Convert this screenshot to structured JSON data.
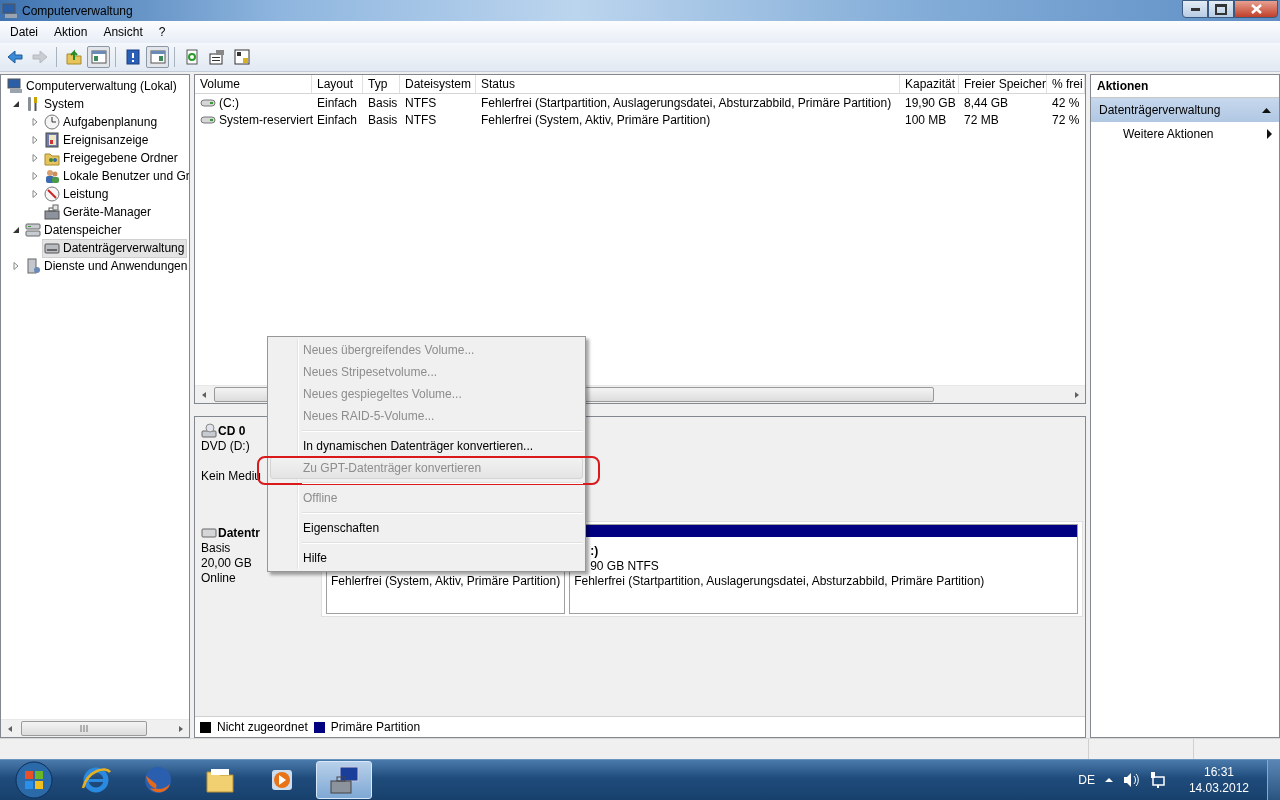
{
  "window": {
    "title": "Computerverwaltung"
  },
  "menu_bar": [
    {
      "label": "Datei"
    },
    {
      "label": "Aktion"
    },
    {
      "label": "Ansicht"
    },
    {
      "label": "?"
    }
  ],
  "toolbar": [
    {
      "kind": "button",
      "disabled": false,
      "pressed": false
    },
    {
      "kind": "button",
      "disabled": true,
      "pressed": false
    },
    {
      "kind": "separator"
    },
    {
      "kind": "button",
      "disabled": false,
      "pressed": false
    },
    {
      "kind": "button",
      "disabled": false,
      "pressed": true
    },
    {
      "kind": "separator"
    },
    {
      "kind": "button",
      "disabled": false,
      "pressed": false
    },
    {
      "kind": "button",
      "disabled": false,
      "pressed": true
    },
    {
      "kind": "separator"
    },
    {
      "kind": "button",
      "disabled": false,
      "pressed": false
    },
    {
      "kind": "button",
      "disabled": false,
      "pressed": false
    },
    {
      "kind": "button",
      "disabled": false,
      "pressed": false
    }
  ],
  "tree": [
    {
      "label": "Computerverwaltung (Lokal)",
      "selected": false,
      "children": [
        {
          "label": "System",
          "kind": "expanded",
          "selected": false,
          "children": [
            {
              "label": "Aufgabenplanung",
              "kind": "collapsed",
              "selected": false
            },
            {
              "label": "Ereignisanzeige",
              "kind": "collapsed",
              "selected": false
            },
            {
              "label": "Freigegebene Ordner",
              "kind": "collapsed",
              "selected": false
            },
            {
              "label": "Lokale Benutzer und Gr",
              "kind": "collapsed",
              "selected": false
            },
            {
              "label": "Leistung",
              "kind": "collapsed",
              "selected": false
            },
            {
              "label": "Geräte-Manager",
              "kind": "leaf",
              "selected": false
            }
          ]
        },
        {
          "label": "Datenspeicher",
          "kind": "expanded",
          "selected": false,
          "children": [
            {
              "label": "Datenträgerverwaltung",
              "kind": "leaf",
              "selected": true
            }
          ]
        },
        {
          "label": "Dienste und Anwendungen",
          "kind": "collapsed",
          "selected": false
        }
      ]
    }
  ],
  "table": {
    "columns": [
      "Volume",
      "Layout",
      "Typ",
      "Dateisystem",
      "Status",
      "Kapazität",
      "Freier Speicher",
      "% frei"
    ],
    "rows": [
      [
        "(C:)",
        "Einfach",
        "Basis",
        "NTFS",
        "Fehlerfrei (Startpartition, Auslagerungsdatei, Absturzabbild, Primäre Partition)",
        "19,90 GB",
        "8,44 GB",
        "42 %"
      ],
      [
        "System-reserviert",
        "Einfach",
        "Basis",
        "NTFS",
        "Fehlerfrei (System, Aktiv, Primäre Partition)",
        "100 MB",
        "72 MB",
        "72 %"
      ]
    ]
  },
  "disks": [
    {
      "kind": "cd",
      "name": "CD 0",
      "type": "DVD (D:)",
      "status": "Kein Mediu"
    },
    {
      "kind": "disk",
      "name": "Datentr",
      "type": "Basis",
      "size": "20,00 GB",
      "status": "Online",
      "partitions": [
        {
          "status": "Fehlerfrei (System, Aktiv, Primäre Partition)"
        },
        {
          "name": ":)",
          "size": "90 GB NTFS",
          "status": "Fehlerfrei (Startpartition, Auslagerungsdatei, Absturzabbild, Primäre Partition)",
          "color": "#000080"
        }
      ]
    }
  ],
  "legend": [
    {
      "label": "Nicht zugeordnet",
      "color": "#000000"
    },
    {
      "label": "Primäre Partition",
      "color": "#000080"
    }
  ],
  "actions": {
    "header": "Aktionen",
    "section": {
      "label": "Datenträgerverwaltung",
      "expanded": true
    },
    "items": [
      {
        "label": "Weitere Aktionen"
      }
    ]
  },
  "context_menu": {
    "items": [
      {
        "kind": "item",
        "label": "Neues übergreifendes Volume...",
        "disabled": true,
        "highlighted": false
      },
      {
        "kind": "item",
        "label": "Neues Stripesetvolume...",
        "disabled": true,
        "highlighted": false
      },
      {
        "kind": "item",
        "label": "Neues gespiegeltes Volume...",
        "disabled": true,
        "highlighted": false
      },
      {
        "kind": "item",
        "label": "Neues RAID-5-Volume...",
        "disabled": true,
        "highlighted": false
      },
      {
        "kind": "separator"
      },
      {
        "kind": "item",
        "label": "In dynamischen Datenträger konvertieren...",
        "disabled": false,
        "highlighted": false
      },
      {
        "kind": "item",
        "label": "Zu GPT-Datenträger konvertieren",
        "disabled": true,
        "highlighted": true,
        "annotated": true
      },
      {
        "kind": "separator"
      },
      {
        "kind": "item",
        "label": "Offline",
        "disabled": true,
        "highlighted": false
      },
      {
        "kind": "separator"
      },
      {
        "kind": "item",
        "label": "Eigenschaften",
        "disabled": false,
        "highlighted": false
      },
      {
        "kind": "separator"
      },
      {
        "kind": "item",
        "label": "Hilfe",
        "disabled": false,
        "highlighted": false
      }
    ]
  },
  "taskbar": {
    "apps": [
      {
        "selected": false
      },
      {
        "selected": false
      },
      {
        "selected": false
      },
      {
        "selected": false
      },
      {
        "selected": true
      }
    ],
    "tray": {
      "language": "DE",
      "time": "16:31",
      "date": "14.03.2012"
    }
  }
}
